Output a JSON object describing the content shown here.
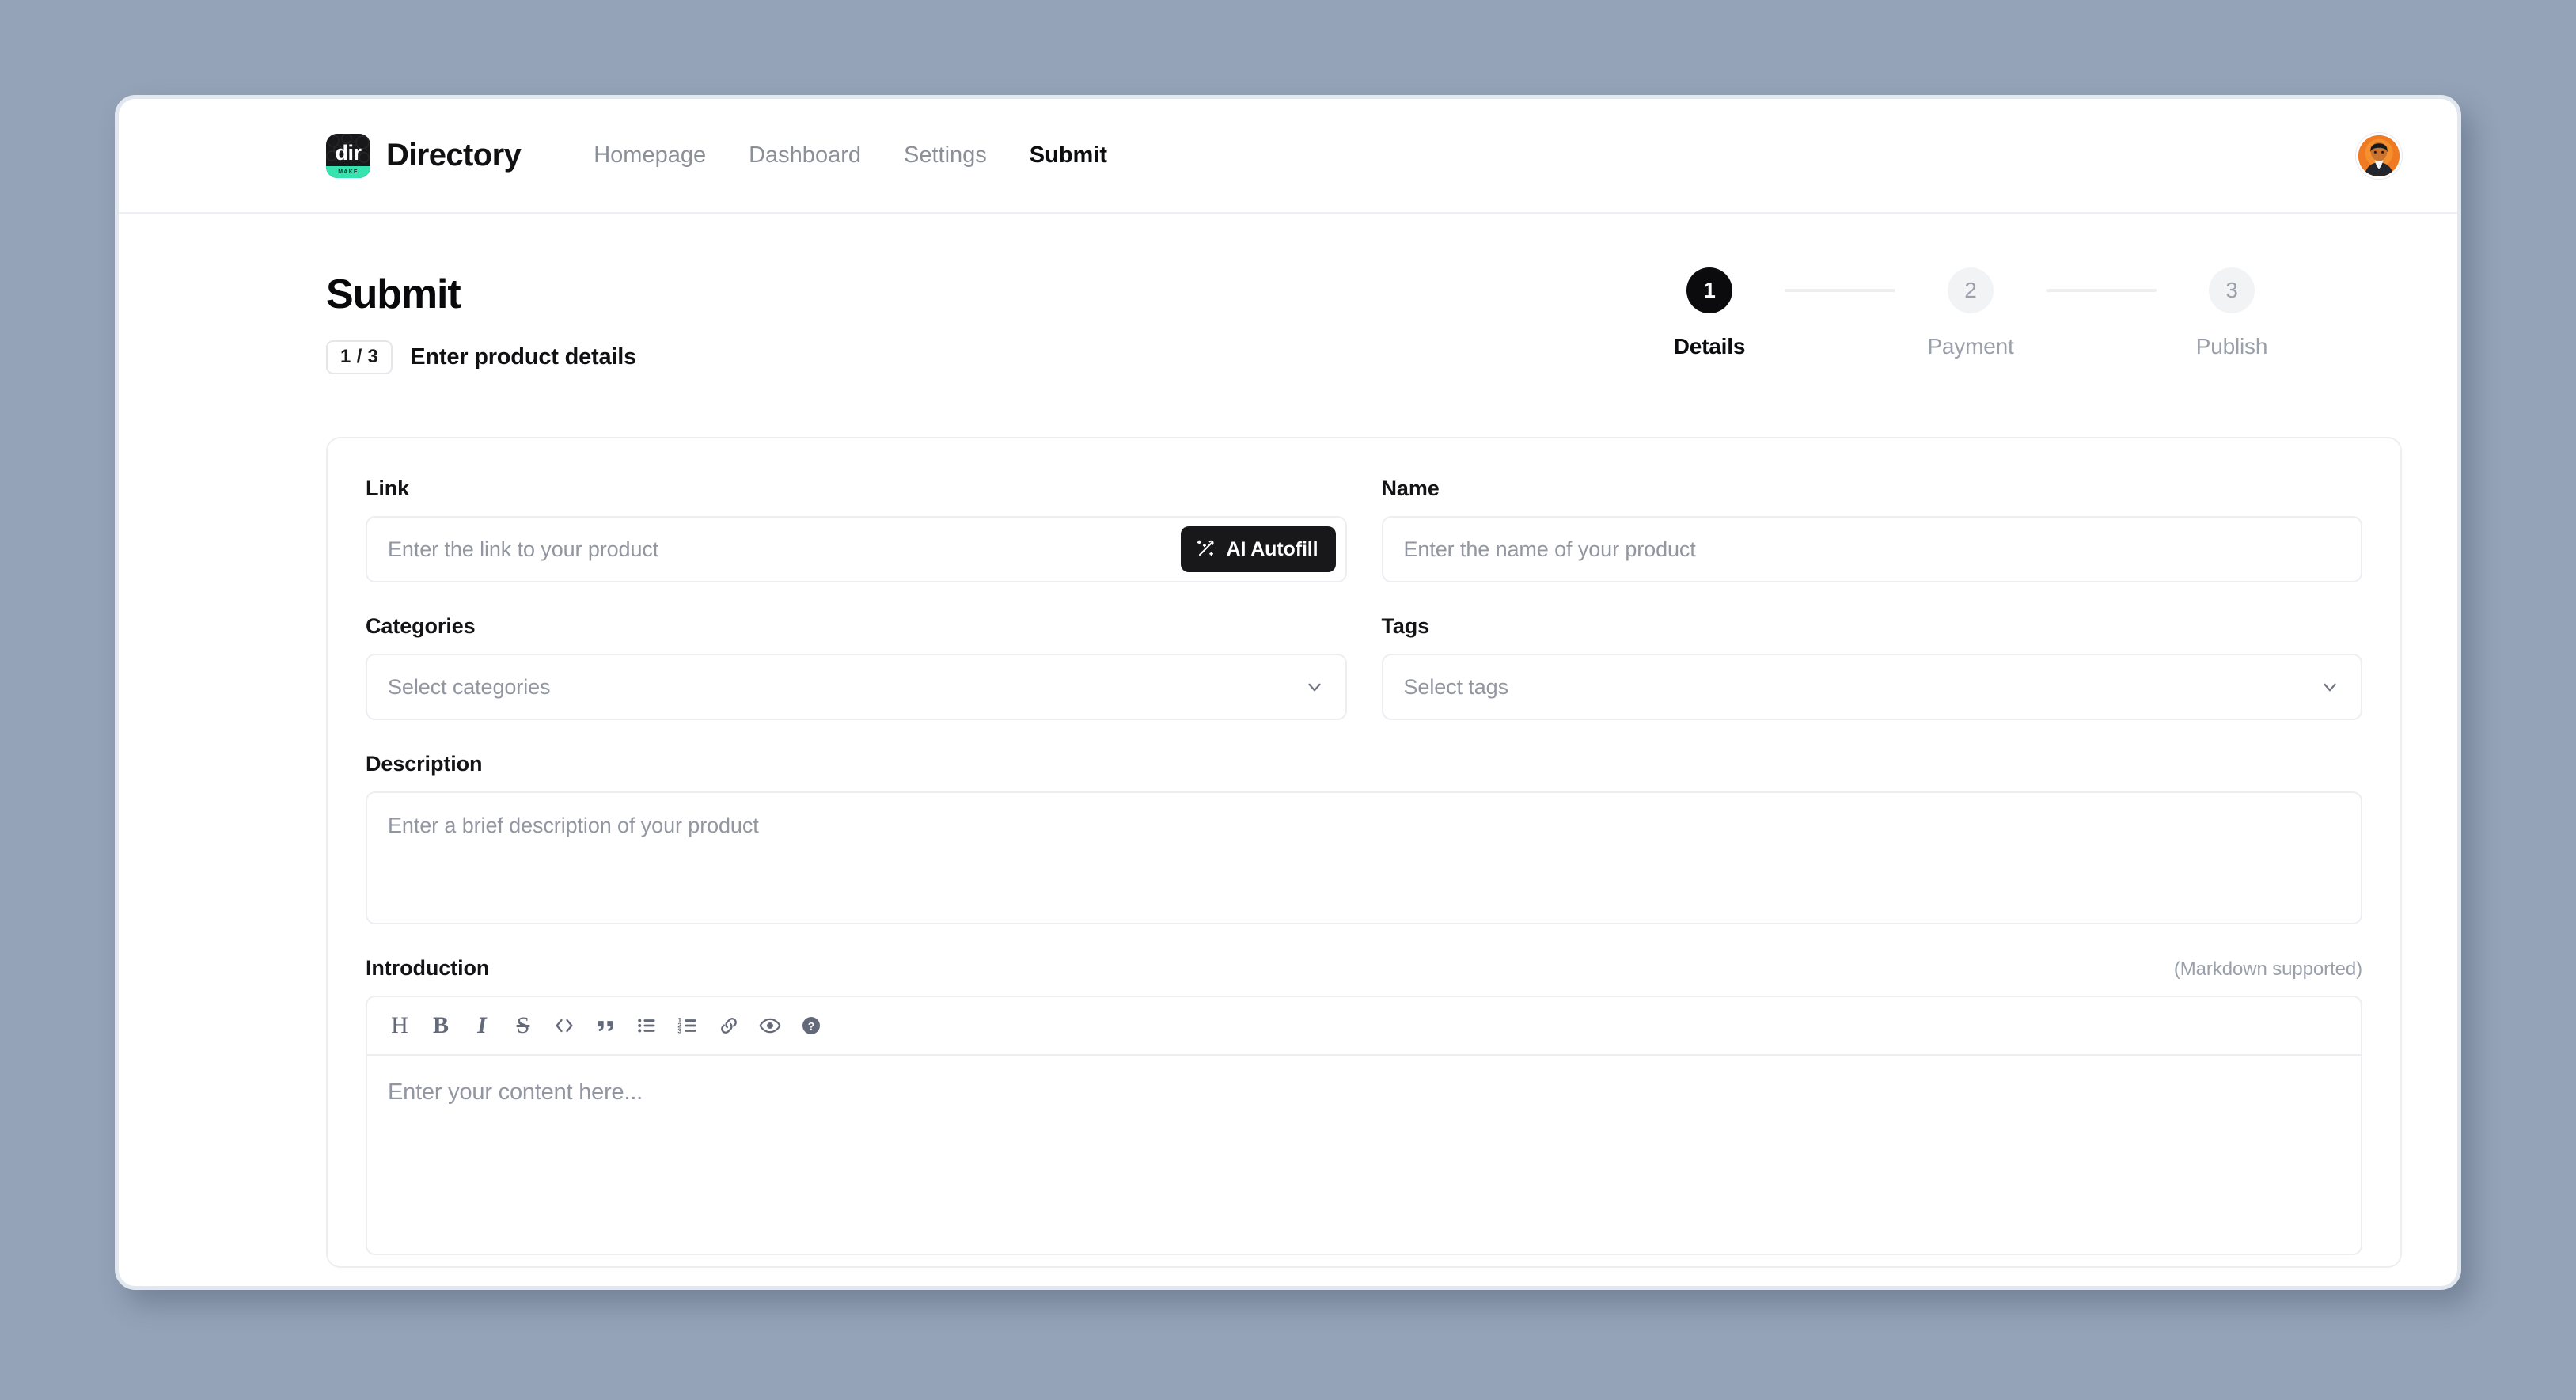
{
  "brand": {
    "logo_text": "dir",
    "logo_sub": "MAKE",
    "name": "Directory"
  },
  "nav": {
    "links": [
      {
        "label": "Homepage",
        "active": false
      },
      {
        "label": "Dashboard",
        "active": false
      },
      {
        "label": "Settings",
        "active": false
      },
      {
        "label": "Submit",
        "active": true
      }
    ],
    "avatar_name": "user-avatar"
  },
  "header": {
    "title": "Submit",
    "step_badge": "1 / 3",
    "subtitle": "Enter product details"
  },
  "stepper": {
    "steps": [
      {
        "number": "1",
        "label": "Details",
        "active": true
      },
      {
        "number": "2",
        "label": "Payment",
        "active": false
      },
      {
        "number": "3",
        "label": "Publish",
        "active": false
      }
    ]
  },
  "form": {
    "link": {
      "label": "Link",
      "placeholder": "Enter the link to your product",
      "value": "",
      "autofill_label": "AI Autofill"
    },
    "name": {
      "label": "Name",
      "placeholder": "Enter the name of your product",
      "value": ""
    },
    "categories": {
      "label": "Categories",
      "placeholder": "Select categories",
      "value": ""
    },
    "tags": {
      "label": "Tags",
      "placeholder": "Select tags",
      "value": ""
    },
    "description": {
      "label": "Description",
      "placeholder": "Enter a brief description of your product",
      "value": ""
    },
    "introduction": {
      "label": "Introduction",
      "hint": "(Markdown supported)",
      "placeholder": "Enter your content here...",
      "value": "",
      "toolbar": [
        {
          "icon": "heading-icon",
          "glyph": "H"
        },
        {
          "icon": "bold-icon",
          "glyph": "B"
        },
        {
          "icon": "italic-icon",
          "glyph": "I"
        },
        {
          "icon": "strikethrough-icon",
          "glyph": "S"
        },
        {
          "icon": "code-icon",
          "glyph": "</>"
        },
        {
          "icon": "quote-icon",
          "glyph": "“"
        },
        {
          "icon": "bullet-list-icon",
          "glyph": ""
        },
        {
          "icon": "numbered-list-icon",
          "glyph": ""
        },
        {
          "icon": "link-icon",
          "glyph": ""
        },
        {
          "icon": "preview-eye-icon",
          "glyph": ""
        },
        {
          "icon": "help-icon",
          "glyph": "?"
        }
      ]
    }
  },
  "colors": {
    "page_background": "#95a3b8",
    "accent_dark": "#18181b",
    "logo_accent": "#34e3ae",
    "border": "#eceef1",
    "placeholder": "#9296a0",
    "muted_text": "#9aa0aa"
  }
}
